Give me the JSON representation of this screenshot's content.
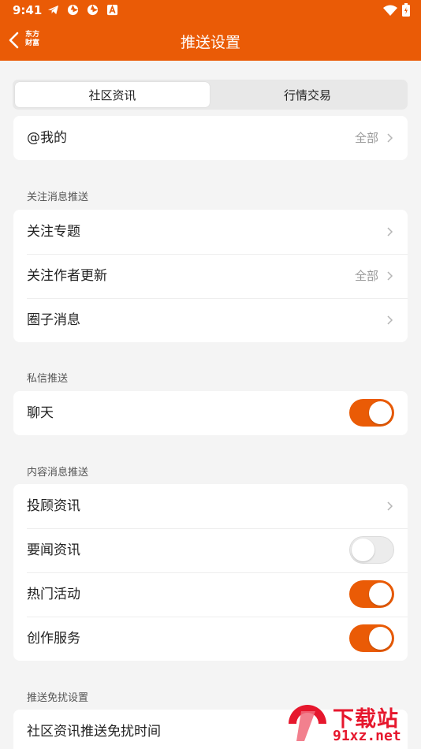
{
  "status_bar": {
    "time": "9:41"
  },
  "nav": {
    "brand_line1": "东方",
    "brand_line2": "财富",
    "title": "推送设置"
  },
  "tabs": [
    {
      "label": "社区资讯",
      "active": true
    },
    {
      "label": "行情交易",
      "active": false
    }
  ],
  "mentions": {
    "label": "@我的",
    "value": "全部"
  },
  "follow": {
    "title": "关注消息推送",
    "items": [
      {
        "label": "关注专题"
      },
      {
        "label": "关注作者更新",
        "value": "全部"
      },
      {
        "label": "圈子消息"
      }
    ]
  },
  "private": {
    "title": "私信推送",
    "items": [
      {
        "label": "聊天",
        "toggle": true
      }
    ]
  },
  "content": {
    "title": "内容消息推送",
    "items": [
      {
        "label": "投顾资讯"
      },
      {
        "label": "要闻资讯",
        "toggle": false
      },
      {
        "label": "热门活动",
        "toggle": true
      },
      {
        "label": "创作服务",
        "toggle": true
      }
    ]
  },
  "dnd": {
    "title": "推送免扰设置",
    "items": [
      {
        "label": "社区资讯推送免扰时间"
      }
    ]
  },
  "watermark": {
    "title": "下载站",
    "domain": "91xz.net"
  },
  "colors": {
    "accent": "#ea5b06",
    "background": "#f4f4f4",
    "watermark": "#e6172d"
  }
}
